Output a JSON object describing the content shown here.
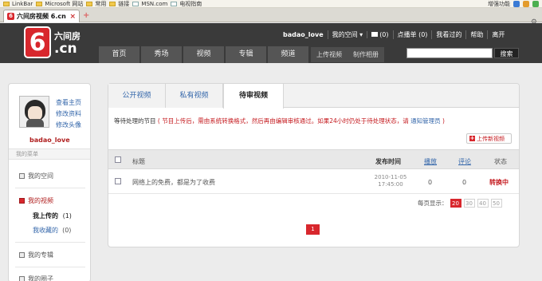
{
  "favorites_bar": {
    "items": [
      {
        "label": "LinkBar",
        "icon": "folder-icon"
      },
      {
        "label": "Microsoft 网站",
        "icon": "folder-icon"
      },
      {
        "label": "常用",
        "icon": "folder-icon"
      },
      {
        "label": "链接",
        "icon": "folder-icon"
      },
      {
        "label": "MSN.com",
        "icon": "page-icon"
      },
      {
        "label": "电视指南",
        "icon": "page-icon"
      }
    ],
    "right_label": "增强功能"
  },
  "browser_tab": {
    "title": "六间房视频 6.cn",
    "favicon": "6"
  },
  "site": {
    "logo": {
      "digit": "6",
      "line1": "六间房",
      "line2": ".cn"
    },
    "top_nav": {
      "user": "badao_love",
      "my_space": "我的空间",
      "messages": "(0)",
      "playlist": "点播单 (0)",
      "watched": "我看过的",
      "help": "帮助",
      "logout": "离开"
    },
    "main_nav": [
      "首页",
      "秀场",
      "视频",
      "专辑",
      "频道"
    ],
    "sub_nav": [
      "上传视频",
      "制作相册"
    ],
    "search": {
      "placeholder": "",
      "button": "搜索"
    }
  },
  "sidebar": {
    "profile_links": [
      "查看主页",
      "修改资料",
      "修改头像"
    ],
    "username": "badao_love",
    "menu_title": "我的菜单",
    "items": [
      {
        "label": "我的空间"
      },
      {
        "label": "我的视频",
        "active": true
      },
      {
        "label": "我的专辑"
      },
      {
        "label": "我的圈子"
      }
    ],
    "video_sub": [
      {
        "label": "我上传的",
        "count": "(1)"
      },
      {
        "label": "我收藏的",
        "count": "(0)"
      }
    ]
  },
  "main": {
    "tabs": [
      "公开视频",
      "私有视频",
      "待审视频"
    ],
    "active_tab": 2,
    "notice": {
      "prefix": "等待处理的节目",
      "warning": "( 节目上传后，需由系统转换格式，然后再由编辑审核通过。如果24小时仍处于待处理状态，请",
      "link": "通知管理员",
      "suffix": ")"
    },
    "upload_button": "上传新视频",
    "columns": {
      "title": "标题",
      "published": "发布时间",
      "plays": "播放",
      "comments": "评论",
      "status": "状态"
    },
    "rows": [
      {
        "title": "网络上的免费，都是为了收费",
        "date": "2010-11-05",
        "time": "17:45:00",
        "plays": "0",
        "comments": "0",
        "status": "转换中"
      }
    ],
    "per_page": {
      "label": "每页显示：",
      "options": [
        "20",
        "30",
        "40",
        "50"
      ],
      "selected": "20"
    },
    "page": "1"
  },
  "colors": {
    "brand_red": "#d8272d",
    "header_bg": "#3a3a3a",
    "link_blue": "#3366aa"
  }
}
